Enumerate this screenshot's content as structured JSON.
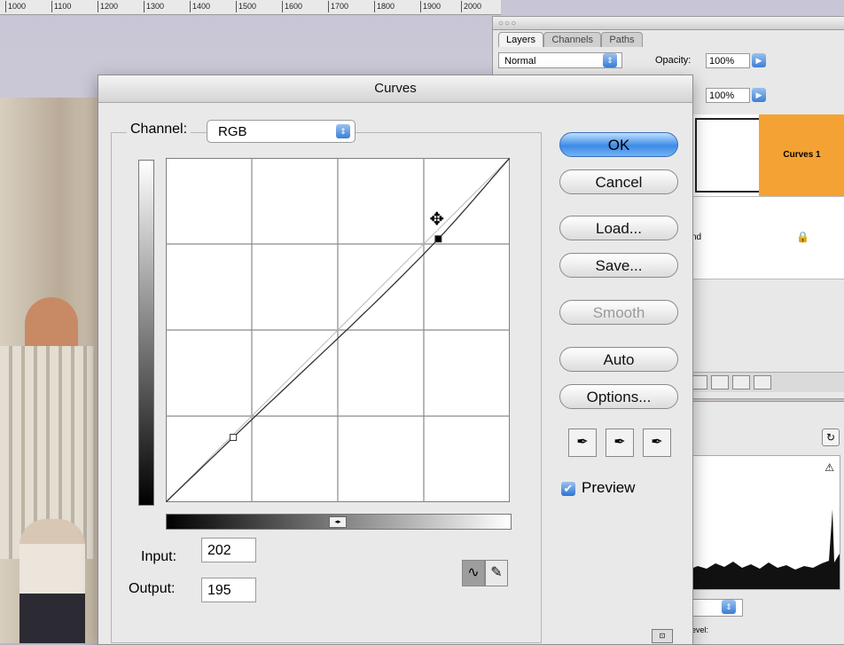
{
  "window": {
    "title": "Curves"
  },
  "ruler": {
    "labels": [
      "1000",
      "1100",
      "1200",
      "1300",
      "1400",
      "1500",
      "1600",
      "1700",
      "1800",
      "1900",
      "2000"
    ]
  },
  "layers_palette": {
    "tabs": [
      "Layers",
      "Channels",
      "Paths"
    ],
    "blend_mode": "Normal",
    "opacity_label": "Opacity:",
    "opacity_value": "100%",
    "fill_value": "100%",
    "layer1_name": "Curves 1",
    "layer2_partial": "nd"
  },
  "histogram_palette": {
    "level_label": "evel:"
  },
  "curves": {
    "channel_label": "Channel:",
    "channel_value": "RGB",
    "input_label": "Input:",
    "input_value": "202",
    "output_label": "Output:",
    "output_value": "195",
    "preview_label": "Preview",
    "preview_checked": true,
    "buttons": {
      "ok": "OK",
      "cancel": "Cancel",
      "load": "Load...",
      "save": "Save...",
      "smooth": "Smooth",
      "auto": "Auto",
      "options": "Options..."
    },
    "curve_points": [
      [
        0,
        0
      ],
      [
        50,
        48
      ],
      [
        202,
        195
      ],
      [
        255,
        255
      ]
    ],
    "selected_point": [
      202,
      195
    ],
    "colors": {
      "ok_accent": "#3d8be6",
      "layer_highlight": "#f5a234"
    }
  }
}
